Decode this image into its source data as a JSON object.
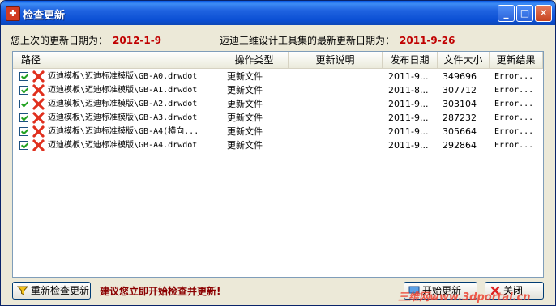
{
  "window": {
    "title": "检查更新"
  },
  "info": {
    "last_update_label": "您上次的更新日期为：",
    "last_update_value": "2012-1-9",
    "latest_label": "迈迪三维设计工具集的最新更新日期为：",
    "latest_value": "2011-9-26"
  },
  "table": {
    "columns": [
      "路径",
      "操作类型",
      "更新说明",
      "发布日期",
      "文件大小",
      "更新结果"
    ],
    "rows": [
      {
        "path": "迈迪模板\\迈迪标准模版\\GB-A0.drwdot",
        "op": "更新文件",
        "desc": "",
        "date": "2011-9...",
        "size": "349696",
        "result": "Error..."
      },
      {
        "path": "迈迪模板\\迈迪标准模版\\GB-A1.drwdot",
        "op": "更新文件",
        "desc": "",
        "date": "2011-8...",
        "size": "307712",
        "result": "Error..."
      },
      {
        "path": "迈迪模板\\迈迪标准模版\\GB-A2.drwdot",
        "op": "更新文件",
        "desc": "",
        "date": "2011-9...",
        "size": "303104",
        "result": "Error..."
      },
      {
        "path": "迈迪模板\\迈迪标准模版\\GB-A3.drwdot",
        "op": "更新文件",
        "desc": "",
        "date": "2011-9...",
        "size": "287232",
        "result": "Error..."
      },
      {
        "path": "迈迪模板\\迈迪标准模版\\GB-A4(横向...",
        "op": "更新文件",
        "desc": "",
        "date": "2011-9...",
        "size": "305664",
        "result": "Error..."
      },
      {
        "path": "迈迪模板\\迈迪标准模版\\GB-A4.drwdot",
        "op": "更新文件",
        "desc": "",
        "date": "2011-9...",
        "size": "292864",
        "result": "Error..."
      }
    ]
  },
  "buttons": {
    "recheck": "重新检查更新",
    "start": "开始更新",
    "close": "关闭"
  },
  "suggestion": "建议您立即开始检查并更新!",
  "watermark": "三维网www.3dportal.cn",
  "colors": {
    "accent_red": "#c00000",
    "title_blue": "#0b4fd4"
  }
}
